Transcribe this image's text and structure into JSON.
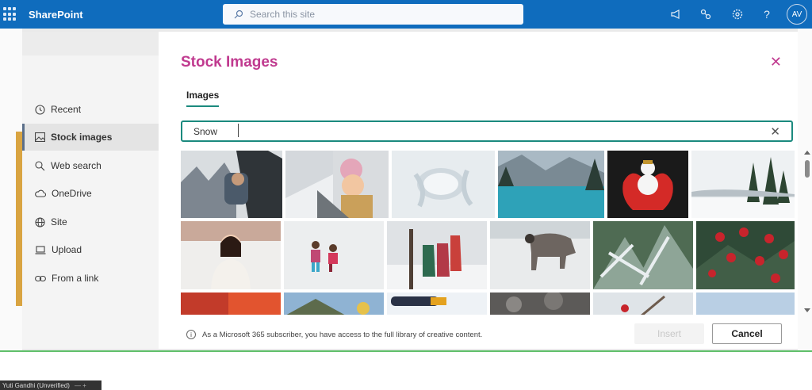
{
  "app": {
    "name": "SharePoint"
  },
  "search": {
    "placeholder": "Search this site"
  },
  "header": {
    "avatar_initials": "AV"
  },
  "dialog": {
    "title": "Stock Images",
    "tabs": [
      {
        "label": "Images"
      }
    ],
    "search_value": "Snow",
    "nav": [
      {
        "label": "Recent"
      },
      {
        "label": "Stock images"
      },
      {
        "label": "Web search"
      },
      {
        "label": "OneDrive"
      },
      {
        "label": "Site"
      },
      {
        "label": "Upload"
      },
      {
        "label": "From a link"
      }
    ],
    "footer_note": "As a Microsoft 365 subscriber, you have access to the full library of creative content.",
    "insert_label": "Insert",
    "cancel_label": "Cancel"
  },
  "participant": {
    "name": "Yuti Gandhi (Unverified)",
    "controls": "— +"
  }
}
